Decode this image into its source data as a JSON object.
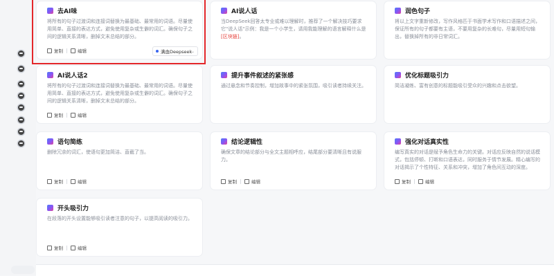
{
  "actions": {
    "copy": "复制",
    "edit": "编辑"
  },
  "cards": [
    {
      "title": "去AI味",
      "desc": "将所有的句子过渡词和连接词替换为最基础、最常用的词语。尽量使用简单、直接的表达方式，避免使用复杂或生僻的词汇。确保句子之间的逻辑关系清晰，删掉文末总结的部分。",
      "run_label": "满血Deepseek"
    },
    {
      "title": "AI说人话",
      "desc_pre": "当DeepSeek回答太专业或难以理解时，推荐了一个解决技巧要求它\"说人话\"示例：我是一个小学生，请用我能理解的语言解释什么是",
      "desc_highlight": "[区块链]",
      "desc_post": "。"
    },
    {
      "title": "润色句子",
      "desc": "将以上文字重新修改，写作风格匹于书面学术写作和口语描述之间，保证所有的句子都要有主语，不要用复杂的长难句，尽量用短句输出，替换掉所有的非日常词汇。"
    },
    {
      "title": "AI说人话2",
      "desc": "将所有的句子过渡词和连接词替换为最基础、最常用的词语。尽量使用简单、直接的表达方式，避免使用复杂或生僻的词汇。确保句子之间的逻辑关系清晰，删掉文末总结的部分。"
    },
    {
      "title": "提升事件叙述的紧张感",
      "desc": "通过悬念和节奏控制，增加故事中的紧张氛围，吸引读者持续关注。"
    },
    {
      "title": "优化标题吸引力",
      "desc": "简洁凝练、富有创意的标题能吸引受众的兴趣和点击欲望。"
    },
    {
      "title": "语句简练",
      "desc": "删除冗余的词汇，使语句更加简洁、直截了当。"
    },
    {
      "title": "结论逻辑性",
      "desc": "确保文章的结论部分与全文主题相呼应，结尾部分要清晰且有说服力。"
    },
    {
      "title": "强化对话真实性",
      "desc": "编写真实的对话是赋予角色生命力的关键。对话应反映自然的说话模式，包括停顿、打断和口语表达，同时服务于情节发展。精心编写的对话揭示了个性特征、关系和冲突，增加了角色间互动的深度。"
    },
    {
      "title": "开头吸引力",
      "desc": "在段落的开头设置能够吸引读者注意的句子，以提高阅读的吸引力。"
    }
  ]
}
